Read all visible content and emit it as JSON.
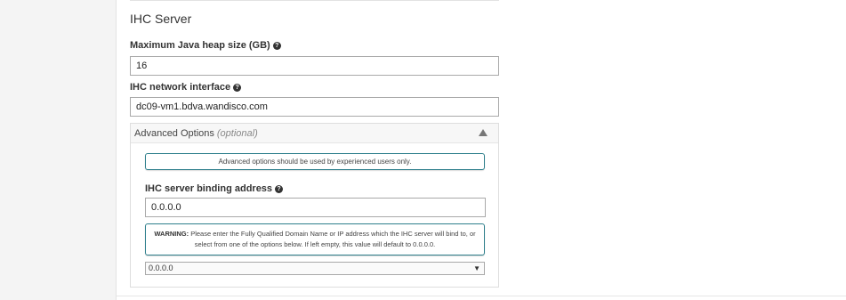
{
  "section": {
    "title": "IHC Server"
  },
  "heap": {
    "label": "Maximum Java heap size (GB)",
    "value": "16"
  },
  "network": {
    "label": "IHC network interface",
    "value": "dc09-vm1.bdva.wandisco.com"
  },
  "advanced": {
    "title": "Advanced Options",
    "optional": "(optional)",
    "info": "Advanced options should be used by experienced users only.",
    "binding": {
      "label": "IHC server binding address",
      "value": "0.0.0.0",
      "warning_label": "WARNING:",
      "warning_text": "Please enter the Fully Qualified Domain Name or IP address which the IHC server will bind to, or select from one of the options below. If left empty, this value will default to 0.0.0.0.",
      "select_value": "0.0.0.0"
    }
  },
  "icons": {
    "help": "question-circle-icon",
    "collapse": "triangle-up-icon",
    "dropdown": "caret-down-icon"
  }
}
